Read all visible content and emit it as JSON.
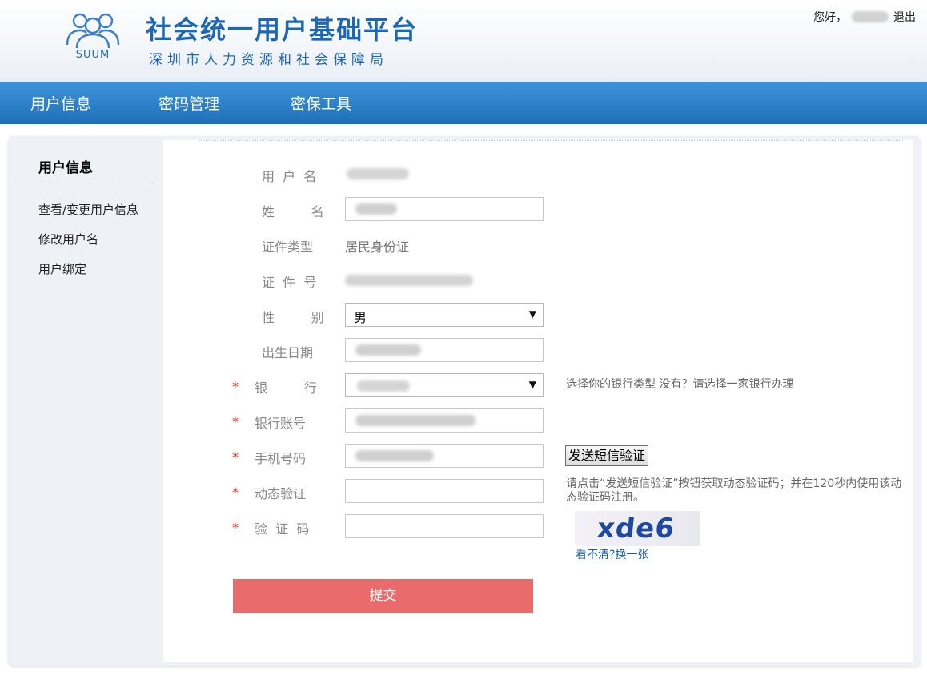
{
  "header": {
    "logo_text": "SUUM",
    "title": "社会统一用户基础平台",
    "subtitle": "深圳市人力资源和社会保障局",
    "greeting": "您好，",
    "logout": "退出"
  },
  "nav": {
    "items": [
      "用户信息",
      "密码管理",
      "密保工具"
    ]
  },
  "sidebar": {
    "title": "用户信息",
    "links": [
      "查看/变更用户信息",
      "修改用户名",
      "用户绑定"
    ]
  },
  "form": {
    "username_label": "用  户  名",
    "name_label": "姓         名",
    "id_type_label": "证件类型",
    "id_type_value": "居民身份证",
    "id_number_label": "证  件  号",
    "gender_label": "性         别",
    "gender_value": "男",
    "birth_label": "出生日期",
    "bank_label": "银         行",
    "bank_hint": "选择你的银行类型  没有？请选择一家银行办理",
    "bank_account_label": "银行账号",
    "phone_label": "手机号码",
    "sms_button": "发送短信验证",
    "dynamic_code_label": "动态验证",
    "dynamic_code_hint": "请点击“发送短信验证”按钮获取动态验证码；并在120秒内使用该动态验证码注册。",
    "captcha_label": "验  证  码",
    "captcha_image_text": "xde6",
    "captcha_refresh": "看不清?换一张",
    "required_mark": "*",
    "submit": "提交"
  },
  "colors": {
    "brand_blue": "#1e67b5",
    "nav_blue": "#2e82c9",
    "submit_red": "#e96b6b",
    "required_red": "#e02020"
  }
}
